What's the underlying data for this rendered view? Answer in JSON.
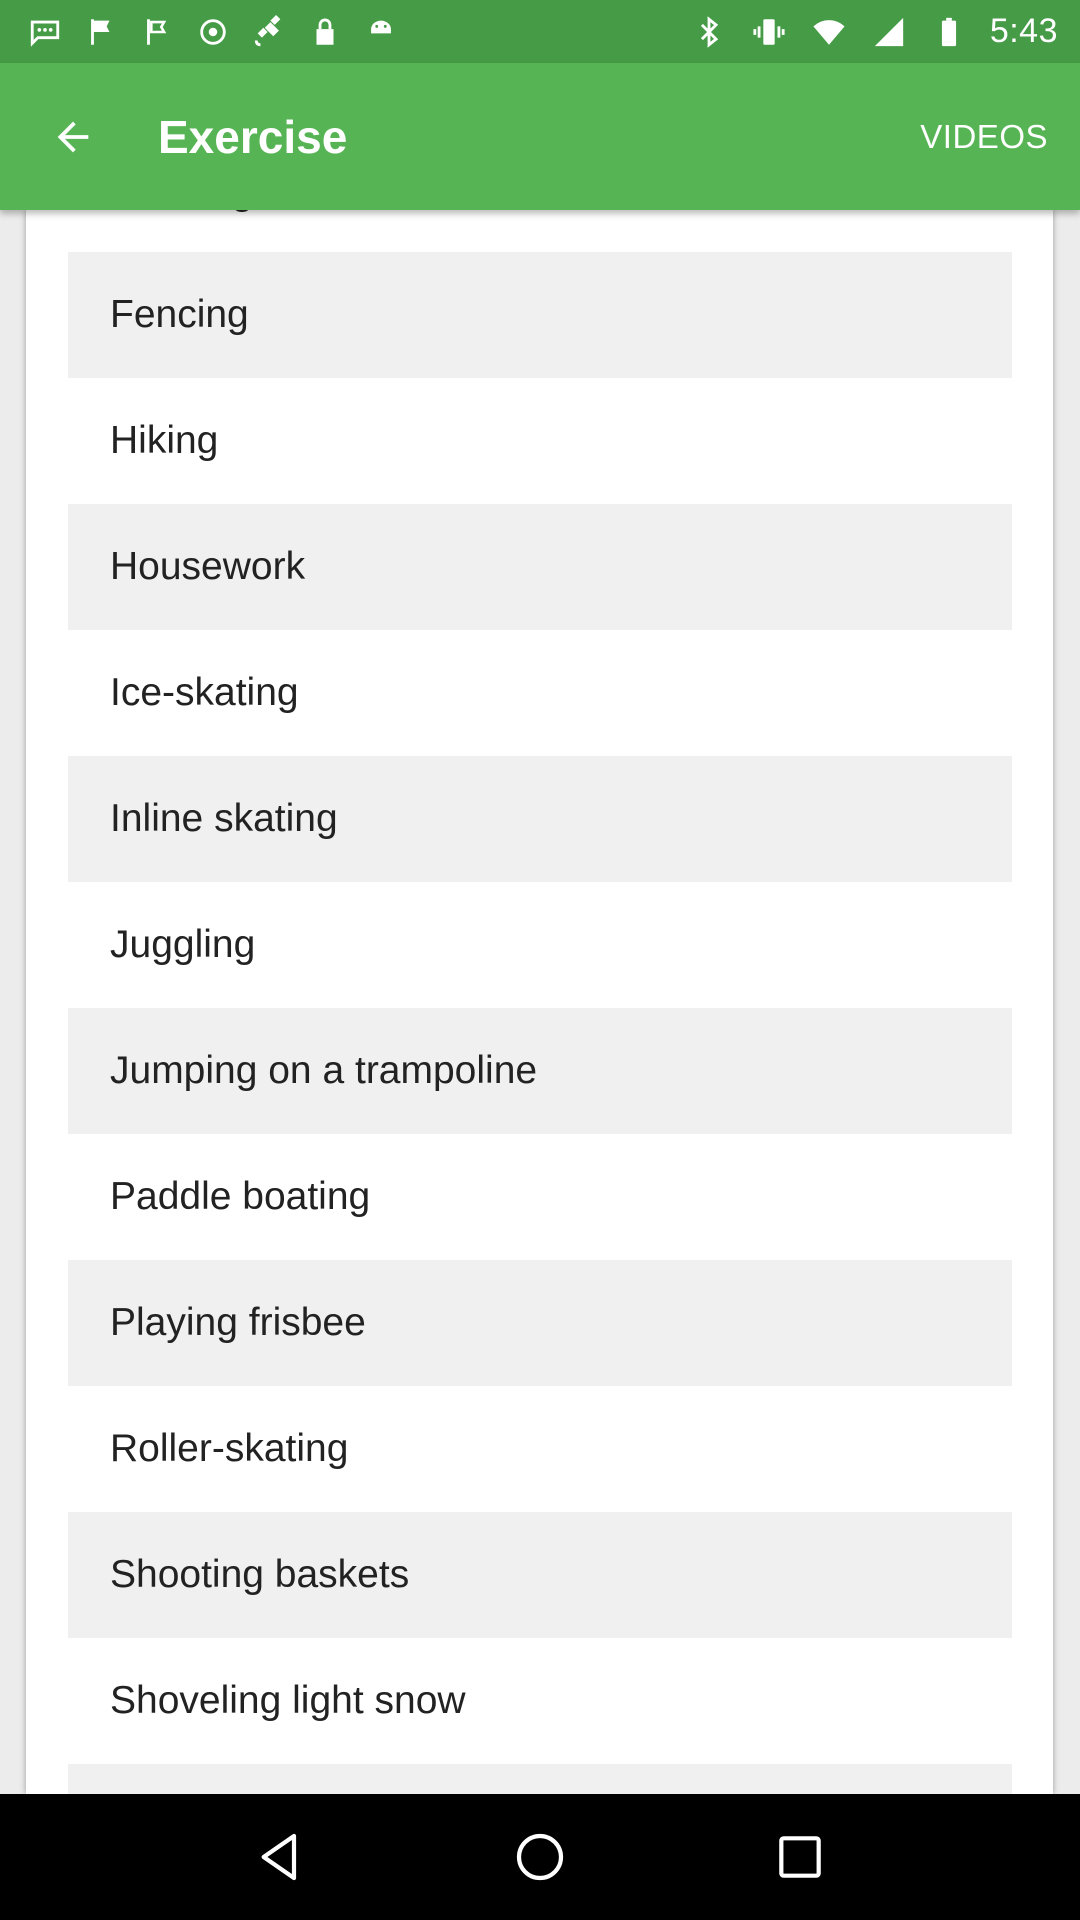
{
  "status_bar": {
    "time": "5:43",
    "left_icons": [
      "message-icon",
      "flag-icon",
      "flag-outline-icon",
      "fake-gps-icon",
      "satellite-icon",
      "lock-icon",
      "android-icon"
    ],
    "right_icons": [
      "bluetooth-icon",
      "vibrate-icon",
      "wifi-icon",
      "signal-icon",
      "battery-icon"
    ]
  },
  "app_bar": {
    "title": "Exercise",
    "action_label": "VIDEOS",
    "color": "#57b454"
  },
  "list": {
    "items": [
      {
        "label": "Fencing",
        "shaded": true
      },
      {
        "label": "Hiking",
        "shaded": false
      },
      {
        "label": "Housework",
        "shaded": true
      },
      {
        "label": "Ice-skating",
        "shaded": false
      },
      {
        "label": "Inline skating",
        "shaded": true
      },
      {
        "label": "Juggling",
        "shaded": false
      },
      {
        "label": "Jumping on a trampoline",
        "shaded": true
      },
      {
        "label": "Paddle boating",
        "shaded": false
      },
      {
        "label": "Playing frisbee",
        "shaded": true
      },
      {
        "label": "Roller-skating",
        "shaded": false
      },
      {
        "label": "Shooting baskets",
        "shaded": true
      },
      {
        "label": "Shoveling light snow",
        "shaded": false
      },
      {
        "label": "",
        "shaded": true
      }
    ]
  },
  "nav_bar": {
    "buttons": [
      "back-nav-icon",
      "home-nav-icon",
      "recents-nav-icon"
    ]
  }
}
